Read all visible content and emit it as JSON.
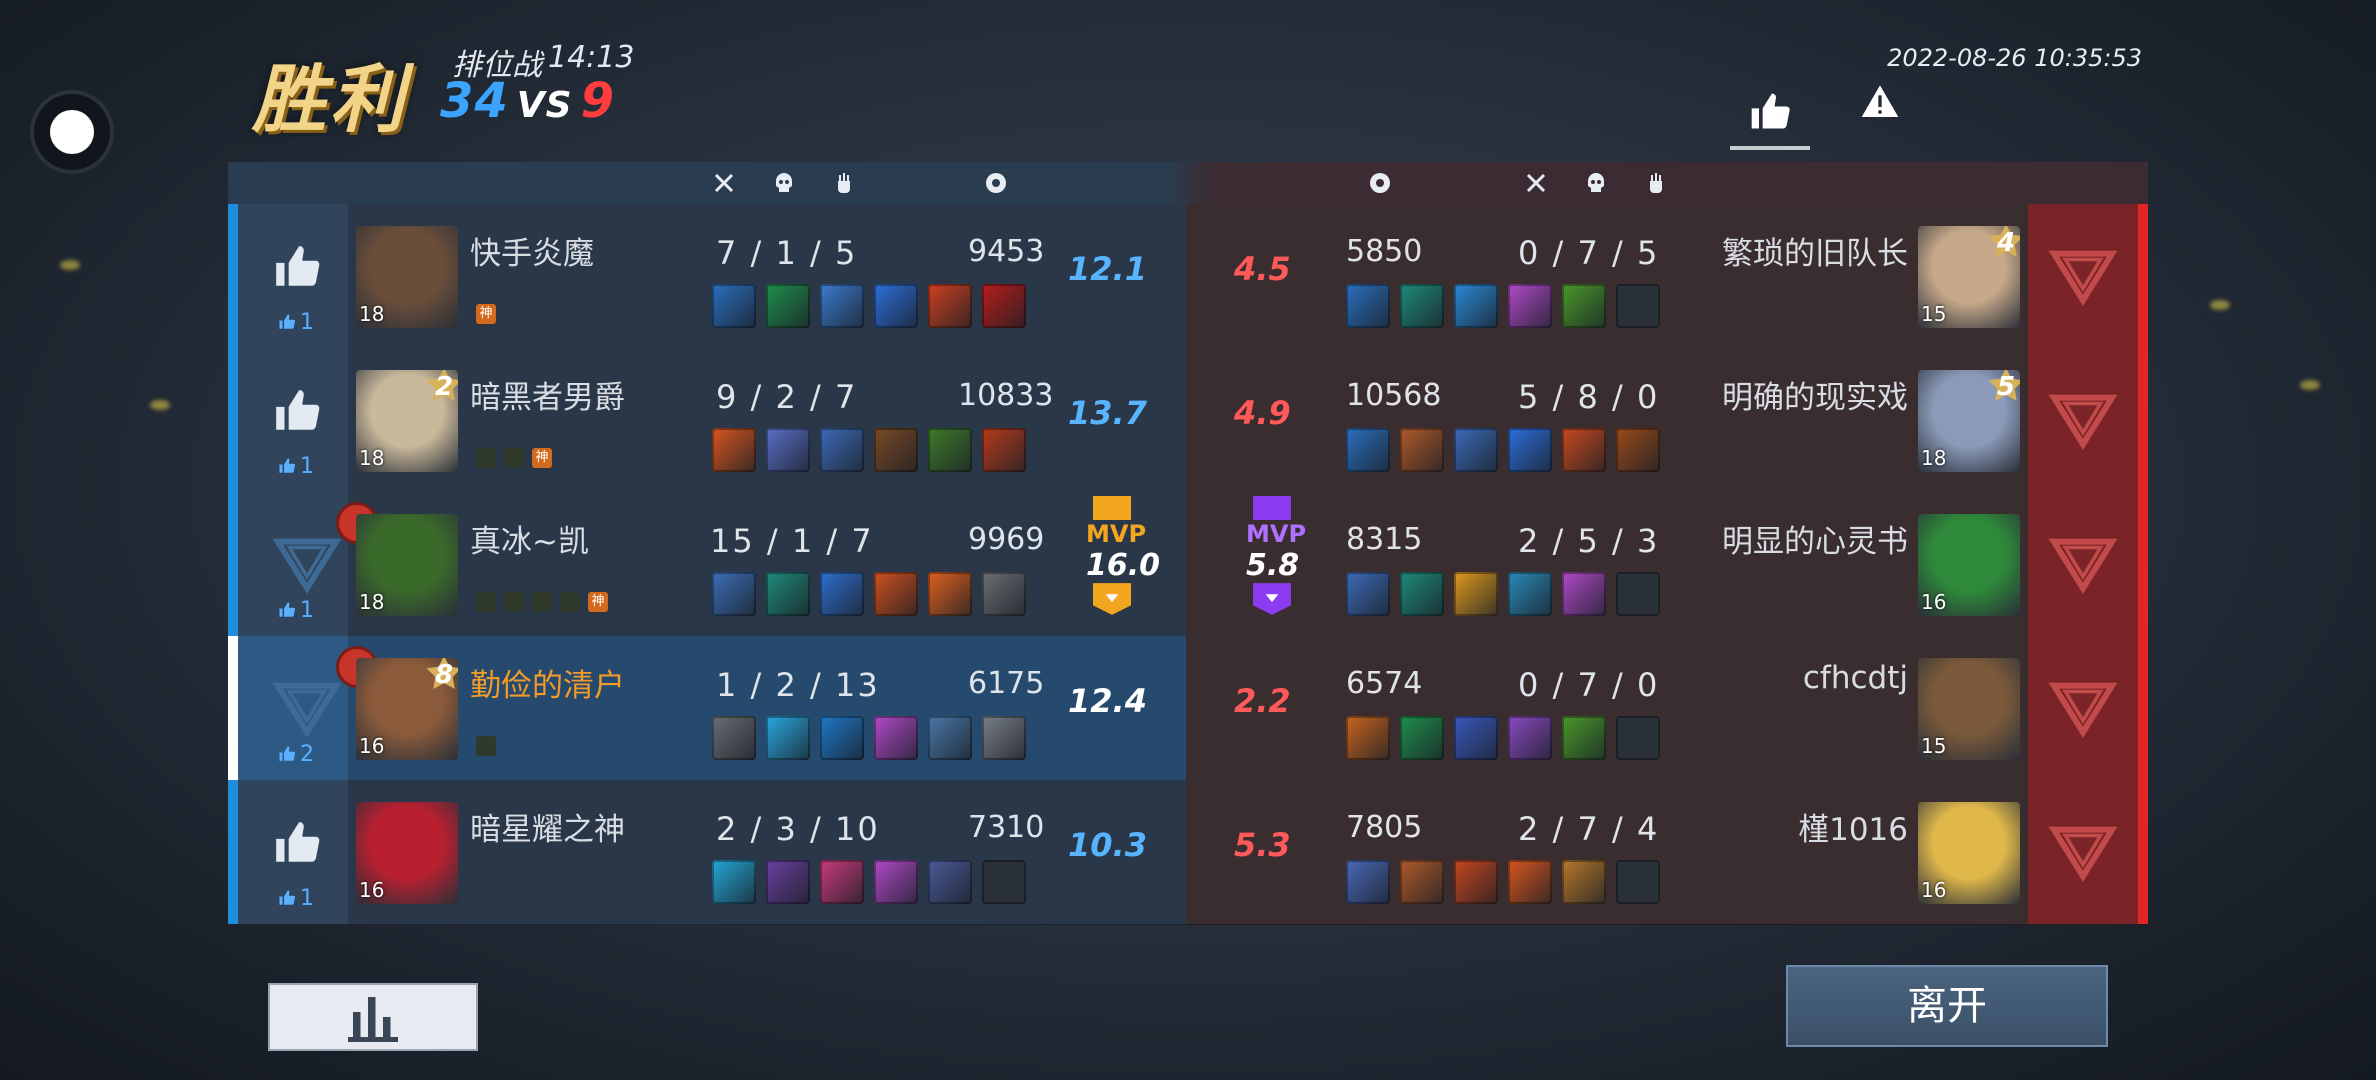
{
  "header": {
    "result": "胜利",
    "mode": "排位战",
    "time": "14:13",
    "score_blue": "34",
    "vs": "VS",
    "score_red": "9",
    "datetime": "2022-08-26 10:35:53"
  },
  "actions": {
    "leave_label": "离开"
  },
  "colors": {
    "blue": "#1e8fe0",
    "red": "#e52525",
    "mvp_gold": "#f3a61f",
    "mvp_purple": "#8c3cf0"
  },
  "left_team": [
    {
      "name": "快手炎魔",
      "level": "18",
      "kda": "7 / 1 / 5",
      "damage": "9453",
      "rating": "12.1",
      "votes": "1",
      "items": [
        "#2b6fbf",
        "#1f8f4c",
        "#3b7bd0",
        "#2d6fdc",
        "#d04020",
        "#b81c1c"
      ],
      "badges": [
        "神"
      ]
    },
    {
      "name": "暗黑者男爵",
      "level": "18",
      "star": "2",
      "kda": "9 / 2 / 7",
      "damage": "10833",
      "rating": "13.7",
      "votes": "1",
      "items": [
        "#d8561e",
        "#5a6fc8",
        "#3c6bb8",
        "#7a4a24",
        "#3f7a2a",
        "#b83a1c"
      ],
      "badges": [
        "b1",
        "b2",
        "神"
      ]
    },
    {
      "name": "真冰~凯",
      "level": "18",
      "kda": "15 / 1 / 7",
      "damage": "9969",
      "rating": "16.0",
      "votes": "1",
      "mvp": "MVP",
      "items": [
        "#3b6fb8",
        "#1f8a7a",
        "#2f6fd0",
        "#d0501e",
        "#e0601e",
        "#6c6f74"
      ],
      "badges": [
        "b1",
        "b2",
        "b3",
        "b4",
        "神"
      ]
    },
    {
      "name": "勤俭的清户",
      "level": "16",
      "star": "8",
      "kda": "1 / 2 / 13",
      "damage": "6175",
      "rating": "12.4",
      "votes": "2",
      "items": [
        "#6a6e74",
        "#2aa8e0",
        "#1e78c8",
        "#b04ac8",
        "#4a78a8",
        "#7a8088"
      ],
      "badges": [
        "b1"
      ]
    },
    {
      "name": "暗星耀之神",
      "level": "16",
      "kda": "2 / 3 / 10",
      "damage": "7310",
      "rating": "10.3",
      "votes": "1",
      "items": [
        "#25a8d8",
        "#6a3f9e",
        "#c83a7a",
        "#b04ac8",
        "#4a5a98",
        "empty"
      ],
      "badges": []
    }
  ],
  "right_team": [
    {
      "name": "繁琐的旧队长",
      "level": "15",
      "star": "4",
      "kda": "0 / 7 / 5",
      "damage": "5850",
      "rating": "4.5",
      "items": [
        "#2b6fbf",
        "#1f8a7a",
        "#2a8ad8",
        "#b04ac8",
        "#4a9a2a",
        "empty"
      ]
    },
    {
      "name": "明确的现实戏",
      "level": "18",
      "star": "5",
      "kda": "5 / 8 / 0",
      "damage": "10568",
      "rating": "4.9",
      "items": [
        "#2b6fbf",
        "#b05a2a",
        "#3c6bb8",
        "#2d6fdc",
        "#c84a1e",
        "#9a4a1a"
      ]
    },
    {
      "name": "明显的心灵书",
      "level": "16",
      "kda": "2 / 5 / 3",
      "damage": "8315",
      "rating": "5.8",
      "mvp": "MVP",
      "items": [
        "#3c6bb8",
        "#1f8a7a",
        "#e09a1e",
        "#2a8ab8",
        "#b04ac8",
        "empty"
      ]
    },
    {
      "name": "cfhcdtj",
      "level": "15",
      "kda": "0 / 7 / 0",
      "damage": "6574",
      "rating": "2.2",
      "items": [
        "#c8641e",
        "#1f8f4c",
        "#3a5ac0",
        "#8a4ac0",
        "#4a9a2a",
        "empty"
      ]
    },
    {
      "name": "槿1016",
      "level": "16",
      "kda": "2 / 7 / 4",
      "damage": "7805",
      "rating": "5.3",
      "items": [
        "#4a68b8",
        "#b05a2a",
        "#c8461e",
        "#d8561e",
        "#b8782a",
        "empty"
      ]
    }
  ]
}
